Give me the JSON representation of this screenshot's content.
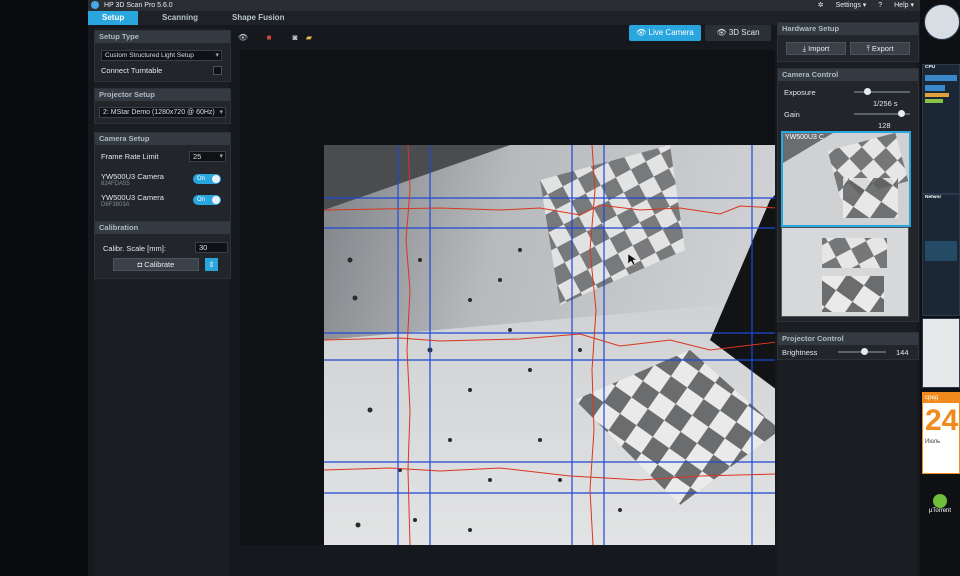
{
  "app": {
    "title": "HP 3D Scan Pro 5.6.0",
    "settings_label": "Settings",
    "help_label": "Help"
  },
  "tabs": [
    {
      "label": "Setup",
      "active": true
    },
    {
      "label": "Scanning",
      "active": false
    },
    {
      "label": "Shape Fusion",
      "active": false
    }
  ],
  "setup_type": {
    "header": "Setup Type",
    "selected": "Custom Structured Light Setup",
    "connect_turntable": "Connect Turntable"
  },
  "projector_setup": {
    "header": "Projector Setup",
    "selected": "2: MStar Demo (1280x720 @ 60Hz)"
  },
  "camera_setup": {
    "header": "Camera Setup",
    "frame_rate_label": "Frame Rate Limit",
    "frame_rate_value": "25",
    "cameras": [
      {
        "name": "YW500U3 Camera",
        "serial": "824FDA55",
        "state": "On"
      },
      {
        "name": "YW500U3 Camera",
        "serial": "D6F3803A",
        "state": "On"
      }
    ]
  },
  "calibration": {
    "header": "Calibration",
    "scale_label": "Calibr. Scale [mm]:",
    "scale_value": "30",
    "calibrate_label": "Calibrate"
  },
  "view_modes": {
    "live_camera": "Live Camera",
    "scan_3d": "3D Scan",
    "active": "live_camera"
  },
  "hardware_setup": {
    "header": "Hardware Setup",
    "import_label": "Import",
    "export_label": "Export"
  },
  "camera_control": {
    "header": "Camera Control",
    "exposure_label": "Exposure",
    "exposure_value": "1/256 s",
    "gain_label": "Gain",
    "gain_value": "128",
    "thumb_label": "YW500U3 C",
    "exposure_fraction": 0.2,
    "gain_fraction": 0.9
  },
  "projector_control": {
    "header": "Projector Control",
    "brightness_label": "Brightness",
    "brightness_value": "144",
    "brightness_fraction": 0.56
  },
  "desktop_gadgets": {
    "cpu_label": "CPU",
    "network_label": "Networ",
    "calendar_day": "24",
    "calendar_weekday": "сред",
    "calendar_month": "Июль",
    "utorrent_label": "µTorrent"
  },
  "colors": {
    "accent": "#2aa6df",
    "panel": "#22262b",
    "header": "#343a41",
    "grid_blue": "#1f47d6",
    "trace_red": "#d9361e"
  }
}
